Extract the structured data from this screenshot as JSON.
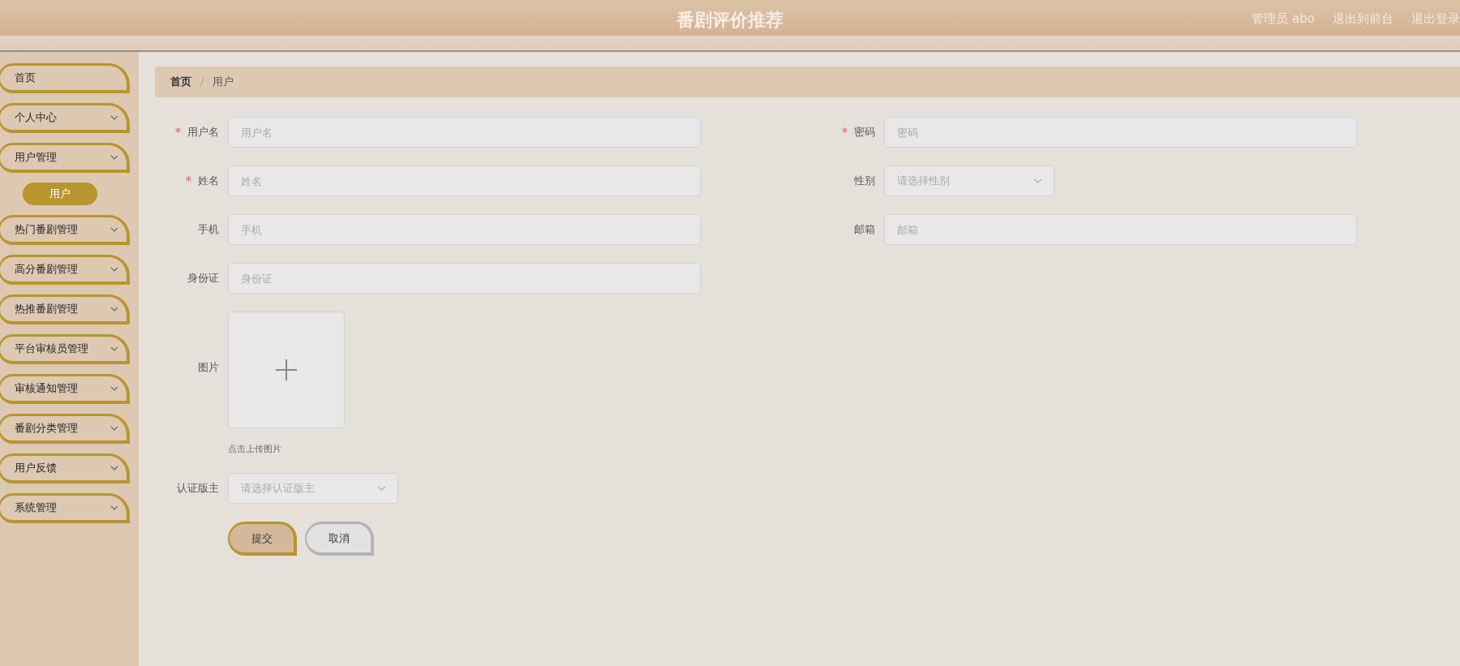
{
  "header": {
    "title": "番剧评价推荐",
    "user": "管理员 abo",
    "links": [
      "退出到前台",
      "退出登录"
    ]
  },
  "sidebar": {
    "items": [
      {
        "label": "首页",
        "kind": "link"
      },
      {
        "label": "个人中心",
        "kind": "group"
      },
      {
        "label": "用户管理",
        "kind": "group",
        "children": [
          {
            "label": "用户",
            "selected": true
          }
        ]
      },
      {
        "label": "热门番剧管理",
        "kind": "group"
      },
      {
        "label": "高分番剧管理",
        "kind": "group"
      },
      {
        "label": "热推番剧管理",
        "kind": "group"
      },
      {
        "label": "平台审核员管理",
        "kind": "group"
      },
      {
        "label": "审核通知管理",
        "kind": "group"
      },
      {
        "label": "番剧分类管理",
        "kind": "group"
      },
      {
        "label": "用户反馈",
        "kind": "group"
      },
      {
        "label": "系统管理",
        "kind": "group"
      }
    ]
  },
  "breadcrumb": [
    "首页",
    "用户"
  ],
  "form": {
    "rows": [
      [
        {
          "label": "用户名",
          "kind": "input",
          "required": true,
          "placeholder": "用户名"
        },
        {
          "label": "密码",
          "kind": "input",
          "required": true,
          "placeholder": "密码"
        }
      ],
      [
        {
          "label": "姓名",
          "kind": "input",
          "required": true,
          "placeholder": "姓名"
        },
        {
          "label": "性别",
          "kind": "select",
          "required": false,
          "placeholder": "请选择性别"
        }
      ],
      [
        {
          "label": "手机",
          "kind": "input",
          "required": false,
          "placeholder": "手机"
        },
        {
          "label": "邮箱",
          "kind": "input",
          "required": false,
          "placeholder": "邮箱"
        }
      ],
      [
        {
          "label": "身份证",
          "kind": "input",
          "required": false,
          "placeholder": "身份证"
        }
      ],
      [
        {
          "label": "图片",
          "kind": "upload",
          "required": false,
          "hint": "点击上传图片"
        }
      ],
      [
        {
          "label": "认证版主",
          "kind": "select",
          "required": false,
          "placeholder": "请选择认证版主"
        }
      ]
    ],
    "buttons": [
      {
        "label": "提交",
        "kind": "primary"
      },
      {
        "label": "取消",
        "kind": "secondary"
      }
    ]
  }
}
